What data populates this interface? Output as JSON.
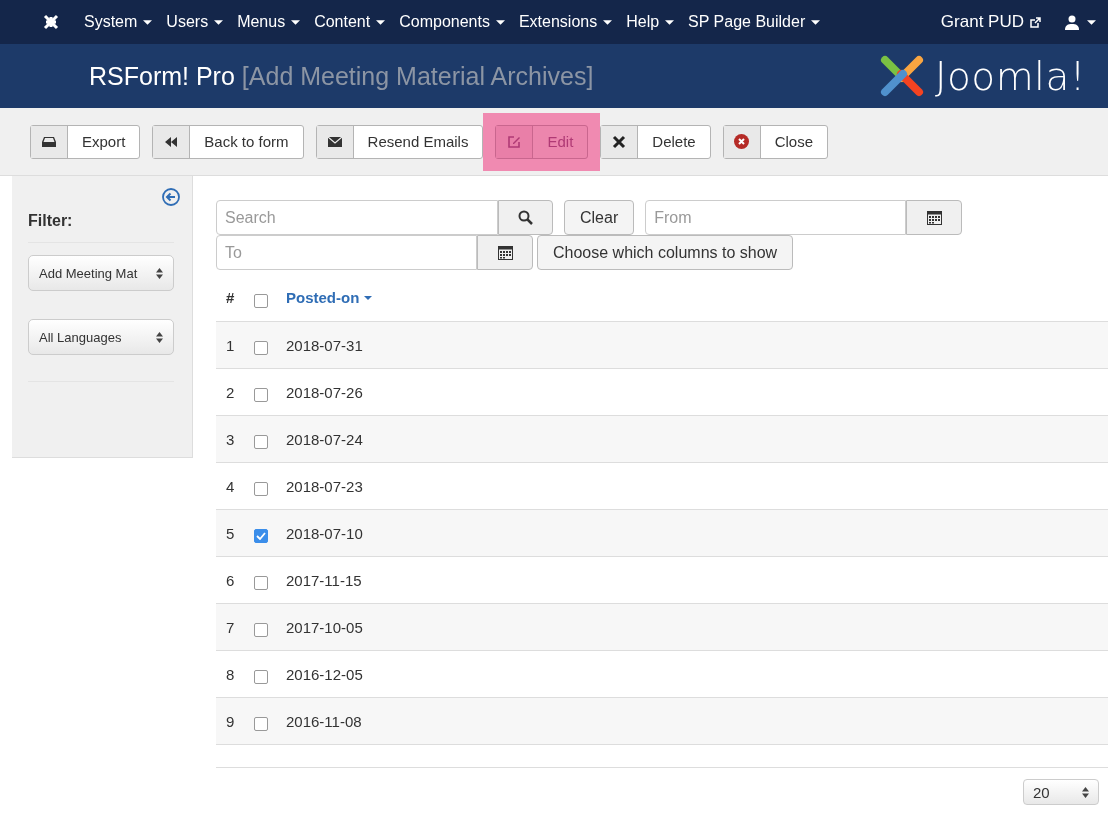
{
  "top_menu": {
    "items": [
      {
        "label": "System"
      },
      {
        "label": "Users"
      },
      {
        "label": "Menus"
      },
      {
        "label": "Content"
      },
      {
        "label": "Components"
      },
      {
        "label": "Extensions"
      },
      {
        "label": "Help"
      },
      {
        "label": "SP Page Builder"
      }
    ],
    "site_link": "Grant PUD"
  },
  "header": {
    "title": "RSForm! Pro",
    "subtitle": "[Add Meeting Material Archives]",
    "logo_text": "Joomla!"
  },
  "toolbar": [
    {
      "kind": "export",
      "label": "Export",
      "highlighted": false
    },
    {
      "kind": "back",
      "label": "Back to form",
      "highlighted": false
    },
    {
      "kind": "mail",
      "label": "Resend Emails",
      "highlighted": false
    },
    {
      "kind": "edit",
      "label": "Edit",
      "highlighted": true
    },
    {
      "kind": "delete",
      "label": "Delete",
      "highlighted": false
    },
    {
      "kind": "close",
      "label": "Close",
      "highlighted": false
    }
  ],
  "sidebar": {
    "heading": "Filter:",
    "selects": [
      {
        "value": "Add Meeting Mat"
      },
      {
        "value": "All Languages"
      }
    ]
  },
  "filters": {
    "search_placeholder": "Search",
    "clear": "Clear",
    "from_placeholder": "From",
    "to_placeholder": "To",
    "columns_button": "Choose which columns to show"
  },
  "table": {
    "columns": [
      "#",
      "Posted-on"
    ],
    "all_checked": false,
    "rows": [
      {
        "num": "1",
        "date": "2018-07-31",
        "checked": false
      },
      {
        "num": "2",
        "date": "2018-07-26",
        "checked": false
      },
      {
        "num": "3",
        "date": "2018-07-24",
        "checked": false
      },
      {
        "num": "4",
        "date": "2018-07-23",
        "checked": false
      },
      {
        "num": "5",
        "date": "2018-07-10",
        "checked": true
      },
      {
        "num": "6",
        "date": "2017-11-15",
        "checked": false
      },
      {
        "num": "7",
        "date": "2017-10-05",
        "checked": false
      },
      {
        "num": "8",
        "date": "2016-12-05",
        "checked": false
      },
      {
        "num": "9",
        "date": "2016-11-08",
        "checked": false
      }
    ]
  },
  "page_size": "20"
}
